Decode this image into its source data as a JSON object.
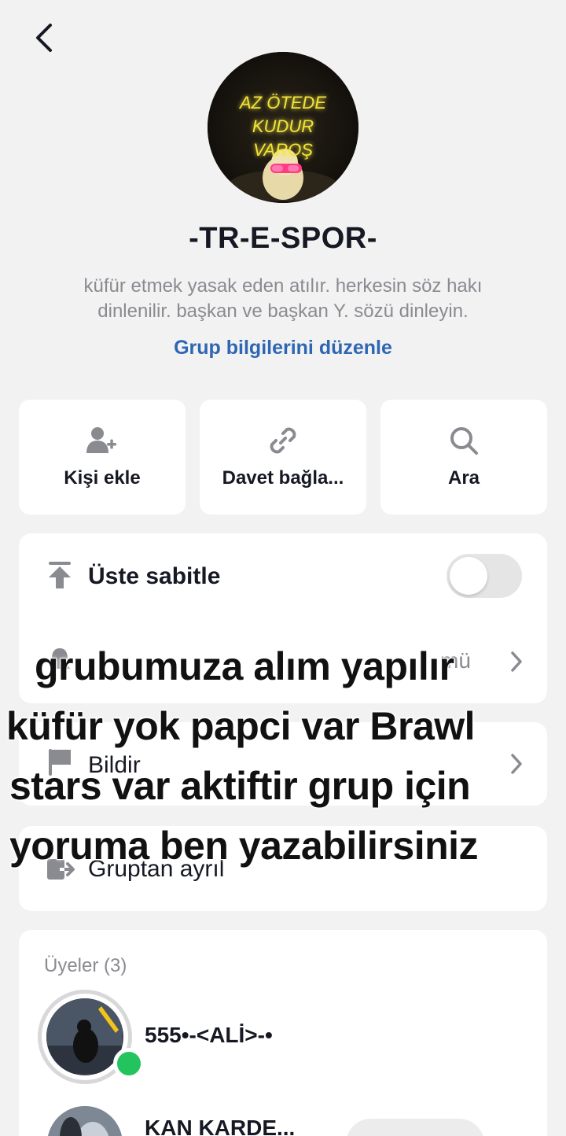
{
  "header": {
    "back_icon": "chevron-left-icon"
  },
  "group": {
    "avatar_text_line1": "AZ ÖTEDE KUDUR",
    "avatar_text_line2": "VAROŞ",
    "name": "-TR-E-SPOR-",
    "description": "küfür etmek yasak eden atılır. herkesin söz hakı dinlenilir. başkan ve başkan Y. sözü dinleyin.",
    "edit_label": "Grup bilgilerini düzenle",
    "accent_color": "#2f66b3"
  },
  "actions": [
    {
      "icon": "add-person-icon",
      "label": "Kişi ekle"
    },
    {
      "icon": "link-icon",
      "label": "Davet bağla..."
    },
    {
      "icon": "search-icon",
      "label": "Ara"
    }
  ],
  "settings": {
    "pin_label": "Üste sabitle",
    "pin_on": false,
    "notifications_value_fragment": "mü"
  },
  "report": {
    "label": "Bildir"
  },
  "leave": {
    "label": "Gruptan ayrıl"
  },
  "members": {
    "title": "Üyeler (3)",
    "list": [
      {
        "name": "555•-<ALİ>-•",
        "online": true
      },
      {
        "name": "KAN KARDE..."
      }
    ]
  },
  "overlay_caption": {
    "line1": "grubumuza alım yapılır",
    "line2": "küfür yok papci var Brawl",
    "line3": "stars var aktiftir grup için",
    "line4": "yoruma ben yazabilirsiniz"
  }
}
